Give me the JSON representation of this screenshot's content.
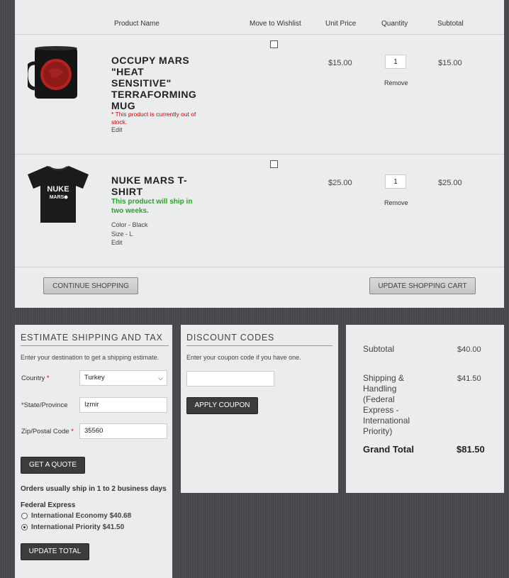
{
  "cart": {
    "headers": {
      "product_name": "Product Name",
      "move_to_wishlist": "Move to Wishlist",
      "unit_price": "Unit Price",
      "quantity": "Quantity",
      "subtotal": "Subtotal"
    },
    "items": [
      {
        "name": "OCCUPY MARS \"HEAT SENSITIVE\" TERRAFORMING MUG",
        "name_lines": [
          "OCCUPY MARS",
          "\"HEAT",
          "SENSITIVE\"",
          "TERRAFORMING",
          "MUG"
        ],
        "notice": "* This product is currently out of stock.",
        "edit": "Edit",
        "unit_price": "$15.00",
        "quantity": "1",
        "remove": "Remove",
        "subtotal": "$15.00",
        "wishlist_checked": false,
        "image_icon": "mug-image"
      },
      {
        "name": "NUKE MARS T-SHIRT",
        "name_lines": [
          "NUKE MARS T-",
          "SHIRT"
        ],
        "ship_notice": "This product will ship in two weeks.",
        "options": [
          "Color - Black",
          "Size - L"
        ],
        "edit": "Edit",
        "unit_price": "$25.00",
        "quantity": "1",
        "remove": "Remove",
        "subtotal": "$25.00",
        "wishlist_checked": false,
        "shirt_text": [
          "NUKE",
          "MARS"
        ],
        "image_icon": "tshirt-image"
      }
    ],
    "continue_label": "CONTINUE SHOPPING",
    "update_label": "UPDATE SHOPPING CART"
  },
  "shipping": {
    "title": "ESTIMATE SHIPPING AND TAX",
    "intro": "Enter your destination to get a shipping estimate.",
    "country_label": "Country",
    "country_value": "Turkey",
    "state_label": "*State/Province",
    "state_value": "Izmir",
    "zip_label": "Zip/Postal Code",
    "zip_value": "35560",
    "quote_label": "GET A QUOTE",
    "ship_time": "Orders usually ship in 1 to 2 business days",
    "carrier": "Federal Express",
    "options": [
      {
        "label": "International Economy",
        "price": "$40.68",
        "selected": false
      },
      {
        "label": "International Priority",
        "price": "$41.50",
        "selected": true
      }
    ],
    "update_total_label": "UPDATE TOTAL"
  },
  "discount": {
    "title": "DISCOUNT CODES",
    "intro": "Enter your coupon code if you have one.",
    "coupon_value": "",
    "apply_label": "APPLY COUPON"
  },
  "totals": {
    "subtotal_label": "Subtotal",
    "subtotal_value": "$40.00",
    "shipping_label_lines": [
      "Shipping &",
      "Handling",
      "(Federal",
      "Express -",
      "International",
      "Priority)"
    ],
    "shipping_value": "$41.50",
    "grand_label": "Grand Total",
    "grand_value": "$81.50"
  },
  "colors": {
    "error": "#d40000",
    "success": "#2aa22a",
    "panel": "#ebeced",
    "background": "#45474b"
  }
}
